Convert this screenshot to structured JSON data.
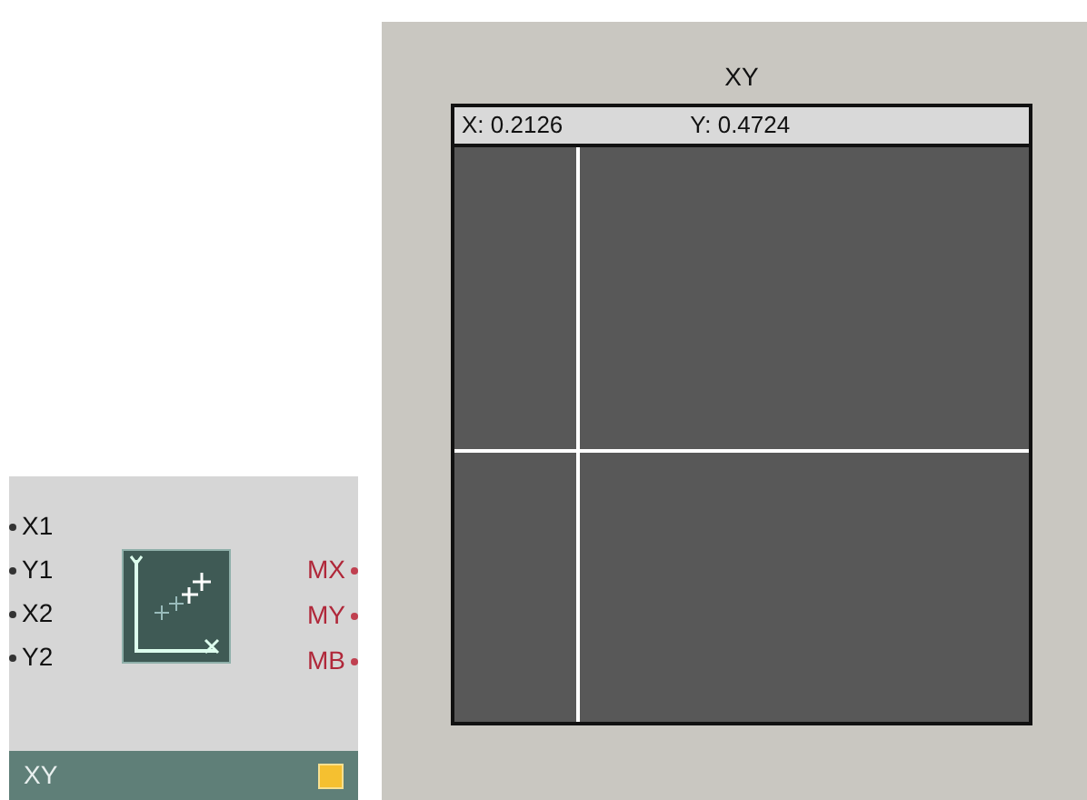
{
  "module": {
    "inputs": [
      "X1",
      "Y1",
      "X2",
      "Y2"
    ],
    "outputs": [
      "MX",
      "MY",
      "MB"
    ],
    "title": "XY",
    "indicator_on": true
  },
  "panel": {
    "title": "XY",
    "x_reading": "X: 0.2126",
    "y_reading": "Y: 0.4724",
    "crosshair_x": {
      "level": 0.2126
    },
    "crosshair_y": {
      "level": 0.4724
    }
  }
}
